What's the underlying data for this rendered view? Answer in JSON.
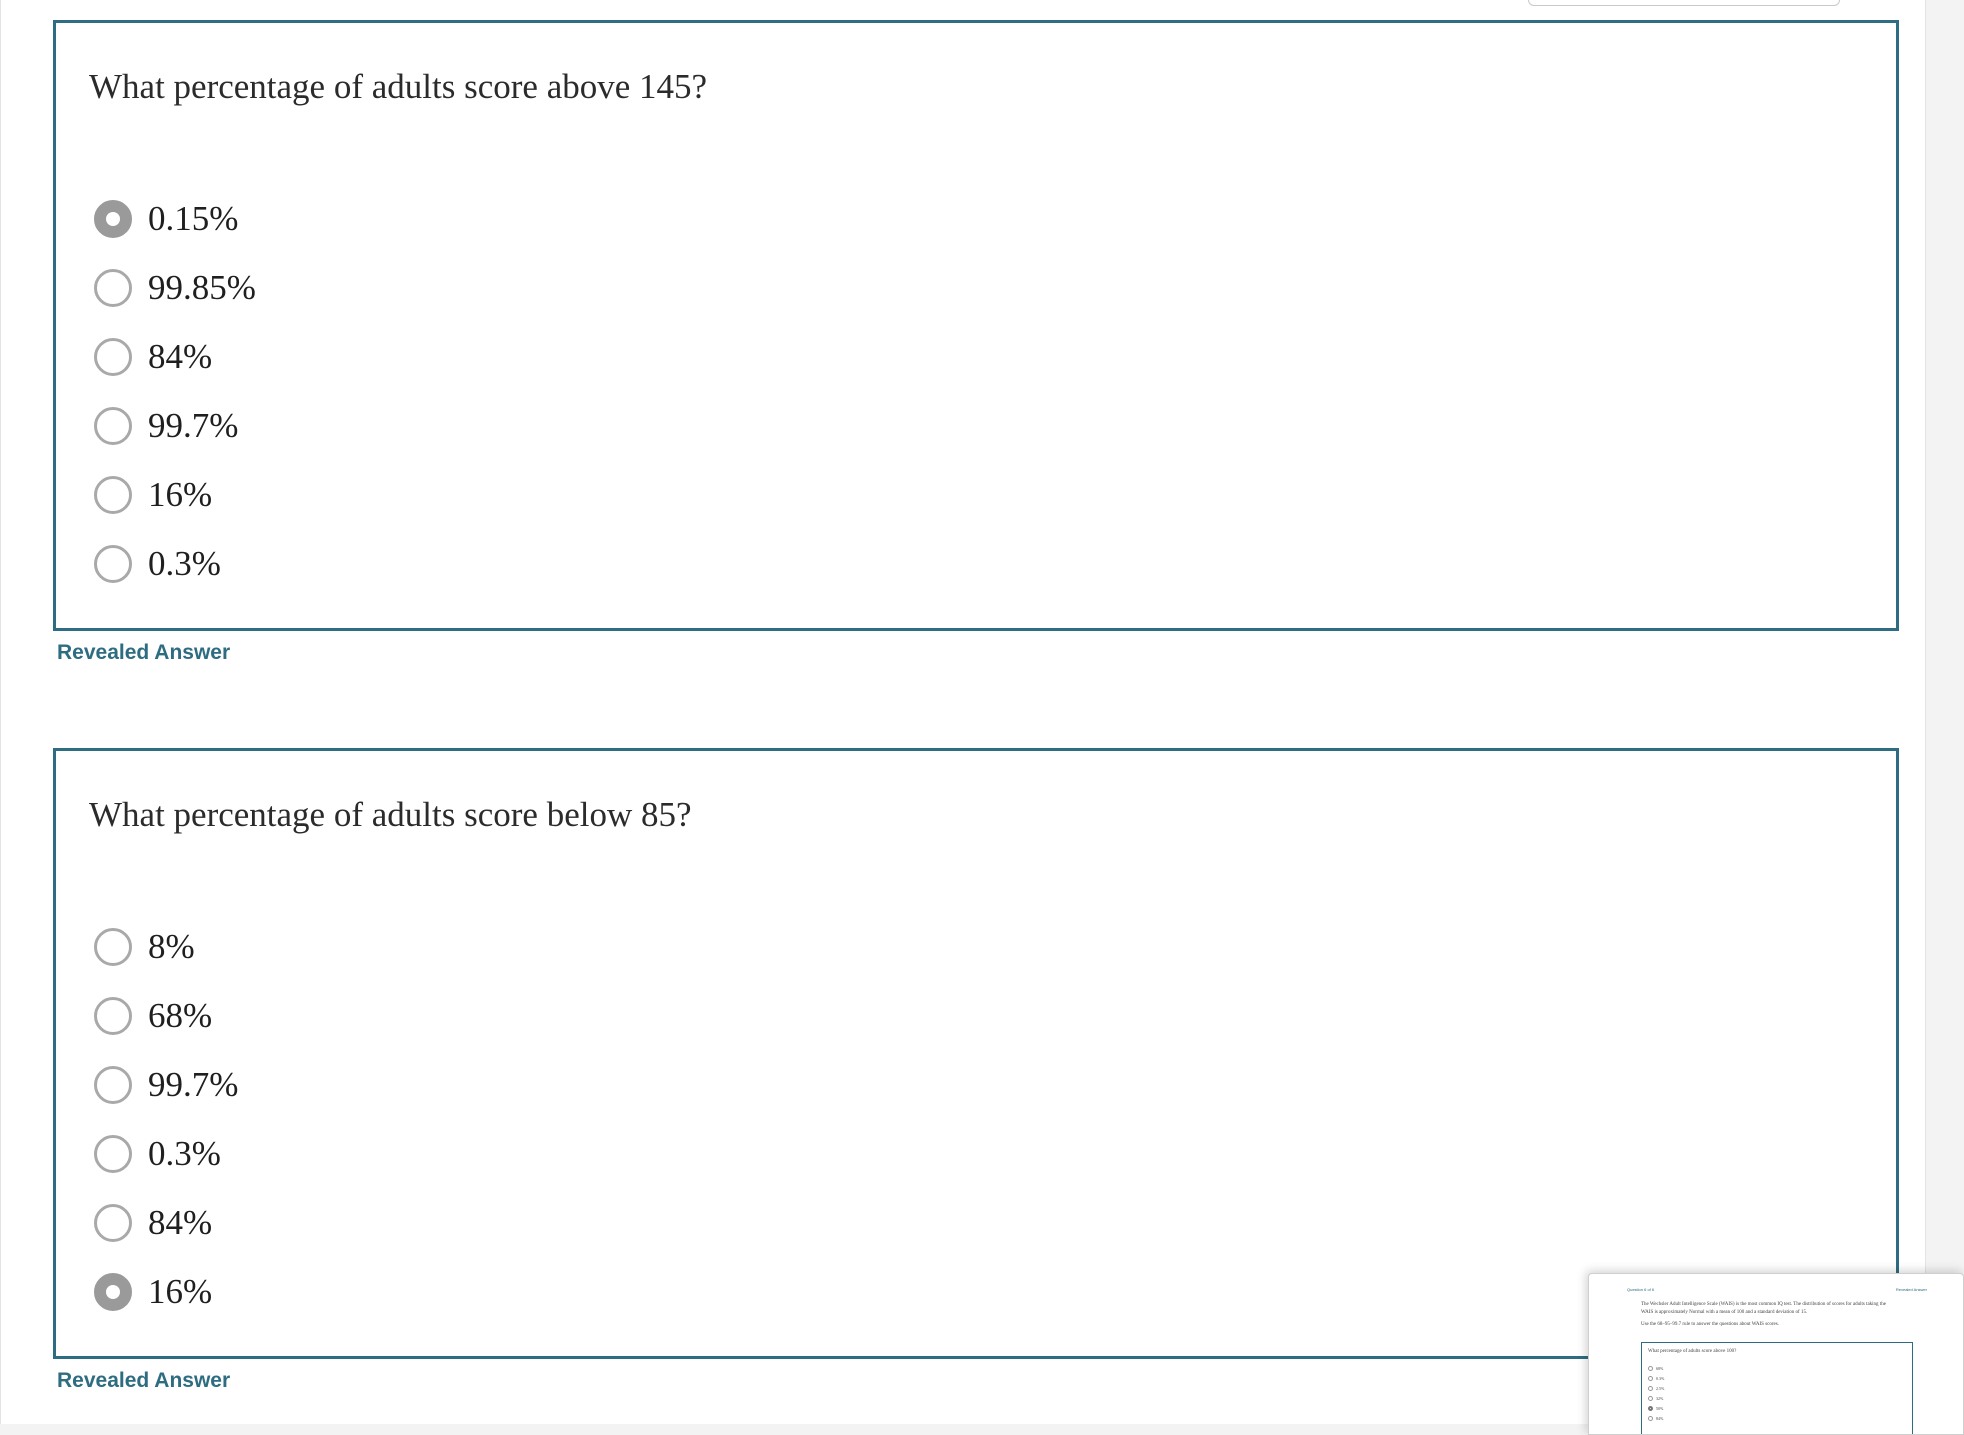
{
  "questions": [
    {
      "text": "What percentage of adults score above 145?",
      "selected_index": 0,
      "options": [
        "0.15%",
        "99.85%",
        "84%",
        "99.7%",
        "16%",
        "0.3%"
      ],
      "revealed_label": "Revealed Answer"
    },
    {
      "text": "What percentage of adults score below 85?",
      "selected_index": 5,
      "options": [
        "8%",
        "68%",
        "99.7%",
        "0.3%",
        "84%",
        "16%"
      ],
      "revealed_label": "Revealed Answer"
    }
  ],
  "thumbnail": {
    "header_left": "Question 6 of 6",
    "header_right": "Revealed Answer",
    "intro_lines": [
      "The Wechsler Adult Intelligence Scale (WAIS) is the most common IQ test. The distribution of scores for adults taking the",
      "WAIS is approximately Normal with a mean of 100 and a standard deviation of 15.",
      "Use the 68–95–99.7 rule to answer the questions about WAIS scores."
    ],
    "question": "What percentage of adults score above 100?",
    "selected_index": 4,
    "options": [
      "68%",
      "0.3%",
      "2.5%",
      "32%",
      "50%",
      "84%"
    ]
  },
  "colors": {
    "accent": "#2e6c82",
    "radio_border": "#a9a9a9",
    "radio_selected": "#9a9a9a"
  }
}
